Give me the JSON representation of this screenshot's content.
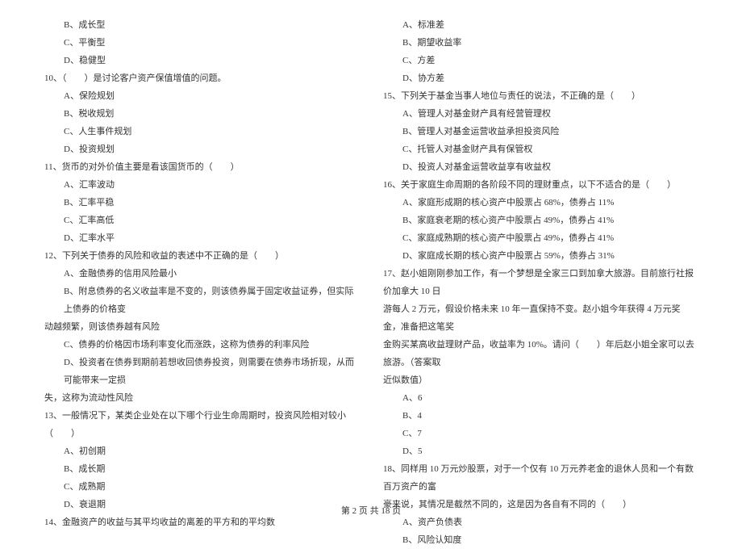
{
  "left_column": [
    {
      "text": "B、成长型",
      "class": "indent-1"
    },
    {
      "text": "C、平衡型",
      "class": "indent-1"
    },
    {
      "text": "D、稳健型",
      "class": "indent-1"
    },
    {
      "text": "10、（　　）是讨论客户资产保值增值的问题。",
      "class": "indent-0"
    },
    {
      "text": "A、保险规划",
      "class": "indent-1"
    },
    {
      "text": "B、税收规划",
      "class": "indent-1"
    },
    {
      "text": "C、人生事件规划",
      "class": "indent-1"
    },
    {
      "text": "D、投资规划",
      "class": "indent-1"
    },
    {
      "text": "11、货币的对外价值主要是看该国货币的（　　）",
      "class": "indent-0"
    },
    {
      "text": "A、汇率波动",
      "class": "indent-1"
    },
    {
      "text": "B、汇率平稳",
      "class": "indent-1"
    },
    {
      "text": "C、汇率高低",
      "class": "indent-1"
    },
    {
      "text": "D、汇率水平",
      "class": "indent-1"
    },
    {
      "text": "12、下列关于债券的风险和收益的表述中不正确的是（　　）",
      "class": "indent-0"
    },
    {
      "text": "A、金融债券的信用风险最小",
      "class": "indent-1"
    },
    {
      "text": "B、附息债券的名义收益率是不变的，则该债券属于固定收益证券，但实际上债券的价格变",
      "class": "indent-1"
    },
    {
      "text": "动越频繁，则该债券越有风险",
      "class": "indent-0"
    },
    {
      "text": "C、债券的价格因市场利率变化而涨跌，这称为债券的利率风险",
      "class": "indent-1"
    },
    {
      "text": "D、投资者在债券到期前若想收回债券投资，则需要在债券市场折现，从而可能带来一定损",
      "class": "indent-1"
    },
    {
      "text": "失，这称为流动性风险",
      "class": "indent-0"
    },
    {
      "text": "13、一般情况下，某类企业处在以下哪个行业生命周期时，投资风险相对较小（　　）",
      "class": "indent-0"
    },
    {
      "text": "A、初创期",
      "class": "indent-1"
    },
    {
      "text": "B、成长期",
      "class": "indent-1"
    },
    {
      "text": "C、成熟期",
      "class": "indent-1"
    },
    {
      "text": "D、衰退期",
      "class": "indent-1"
    },
    {
      "text": "14、金融资产的收益与其平均收益的离差的平方和的平均数",
      "class": "indent-0"
    }
  ],
  "right_column": [
    {
      "text": "A、标准差",
      "class": "indent-1"
    },
    {
      "text": "B、期望收益率",
      "class": "indent-1"
    },
    {
      "text": "C、方差",
      "class": "indent-1"
    },
    {
      "text": "D、协方差",
      "class": "indent-1"
    },
    {
      "text": "15、下列关于基金当事人地位与责任的说法，不正确的是（　　）",
      "class": "indent-0"
    },
    {
      "text": "A、管理人对基金财产具有经营管理权",
      "class": "indent-1"
    },
    {
      "text": "B、管理人对基金运营收益承担投资风险",
      "class": "indent-1"
    },
    {
      "text": "C、托管人对基金财产具有保管权",
      "class": "indent-1"
    },
    {
      "text": "D、投资人对基金运营收益享有收益权",
      "class": "indent-1"
    },
    {
      "text": "16、关于家庭生命周期的各阶段不同的理财重点，以下不适合的是（　　）",
      "class": "indent-0"
    },
    {
      "text": "A、家庭形成期的核心资产中股票占 68%，债券占 11%",
      "class": "indent-1"
    },
    {
      "text": "B、家庭衰老期的核心资产中股票占 49%，债券占 41%",
      "class": "indent-1"
    },
    {
      "text": "C、家庭成熟期的核心资产中股票占 49%，债券占 41%",
      "class": "indent-1"
    },
    {
      "text": "D、家庭成长期的核心资产中股票占 59%，债券占 31%",
      "class": "indent-1"
    },
    {
      "text": "17、赵小姐刚刚参加工作，有一个梦想是全家三口到加拿大旅游。目前旅行社报价加拿大 10 日",
      "class": "indent-0"
    },
    {
      "text": "游每人 2 万元，假设价格未来 10 年一直保持不变。赵小姐今年获得 4 万元奖金，准备把这笔奖",
      "class": "indent-0"
    },
    {
      "text": "金购买某高收益理财产品，收益率为 10%。请问（　　）年后赵小姐全家可以去旅游。（答案取",
      "class": "indent-0"
    },
    {
      "text": "近似数值）",
      "class": "indent-0"
    },
    {
      "text": "A、6",
      "class": "indent-1"
    },
    {
      "text": "B、4",
      "class": "indent-1"
    },
    {
      "text": "C、7",
      "class": "indent-1"
    },
    {
      "text": "D、5",
      "class": "indent-1"
    },
    {
      "text": "18、同样用 10 万元炒股票，对于一个仅有 10 万元养老金的退休人员和一个有数百万资产的富",
      "class": "indent-0"
    },
    {
      "text": "豪来说，其情况是截然不同的，这是因为各自有不同的（　　）",
      "class": "indent-0"
    },
    {
      "text": "A、资产负债表",
      "class": "indent-1"
    },
    {
      "text": "B、风险认知度",
      "class": "indent-1"
    }
  ],
  "footer": "第 2 页 共 18 页"
}
